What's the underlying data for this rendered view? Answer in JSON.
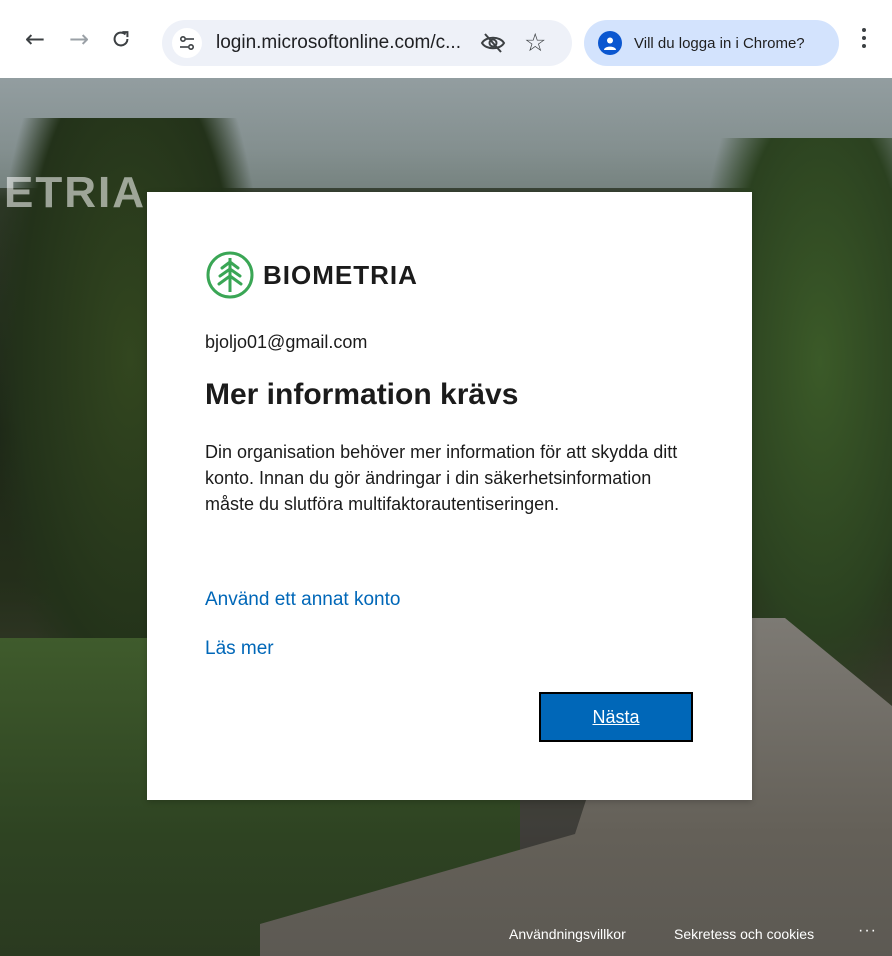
{
  "browser": {
    "url": "login.microsoftonline.com/c...",
    "profile_prompt": "Vill du logga in i Chrome?",
    "nav_back": "←",
    "nav_forward": "→",
    "nav_reload": "C",
    "star": "☆"
  },
  "background": {
    "brand_text": "ETRIA"
  },
  "card": {
    "brand_name": "BIOMETRIA",
    "identity": "bjoljo01@gmail.com",
    "title": "Mer information krävs",
    "description": "Din organisation behöver mer information för att skydda ditt konto. Innan du gör ändringar i din säkerhetsinformation måste du slutföra multifaktorautentiseringen.",
    "link_other_account": "Använd ett annat konto",
    "link_learn_more": "Läs mer",
    "next_button": "Nästa"
  },
  "footer": {
    "terms": "Användningsvillkor",
    "privacy": "Sekretess och cookies",
    "more": "···"
  },
  "colors": {
    "accent": "#0067b8",
    "brand_green": "#3aa655",
    "chip_bg": "#d3e3fd"
  }
}
